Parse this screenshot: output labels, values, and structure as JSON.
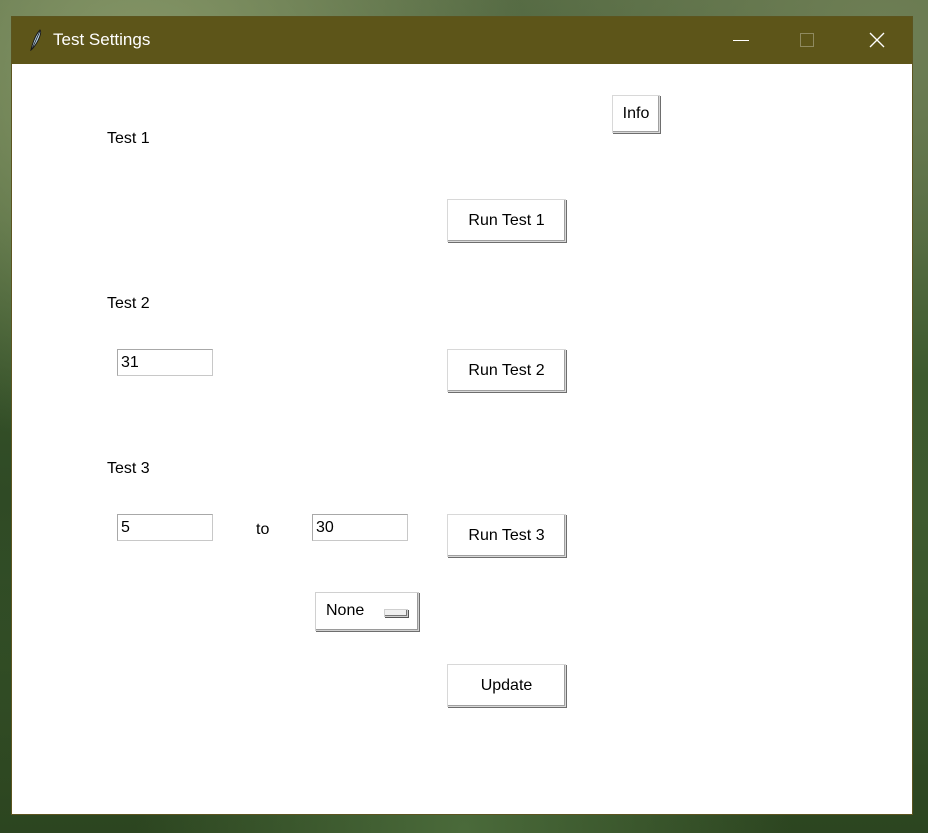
{
  "window": {
    "title": "Test Settings",
    "titlebar_color": "#5d5519",
    "app_icon": "feather-icon"
  },
  "controls": {
    "minimize": "minimize-icon",
    "maximize": "maximize-icon",
    "close": "close-icon"
  },
  "info_button": "Info",
  "test1": {
    "label": "Test 1",
    "run_button": "Run Test 1"
  },
  "test2": {
    "label": "Test 2",
    "value": "31",
    "run_button": "Run Test 2"
  },
  "test3": {
    "label": "Test 3",
    "from_value": "5",
    "to_label": "to",
    "to_value": "30",
    "run_button": "Run Test 3"
  },
  "dropdown": {
    "selected": "None"
  },
  "update_button": "Update"
}
